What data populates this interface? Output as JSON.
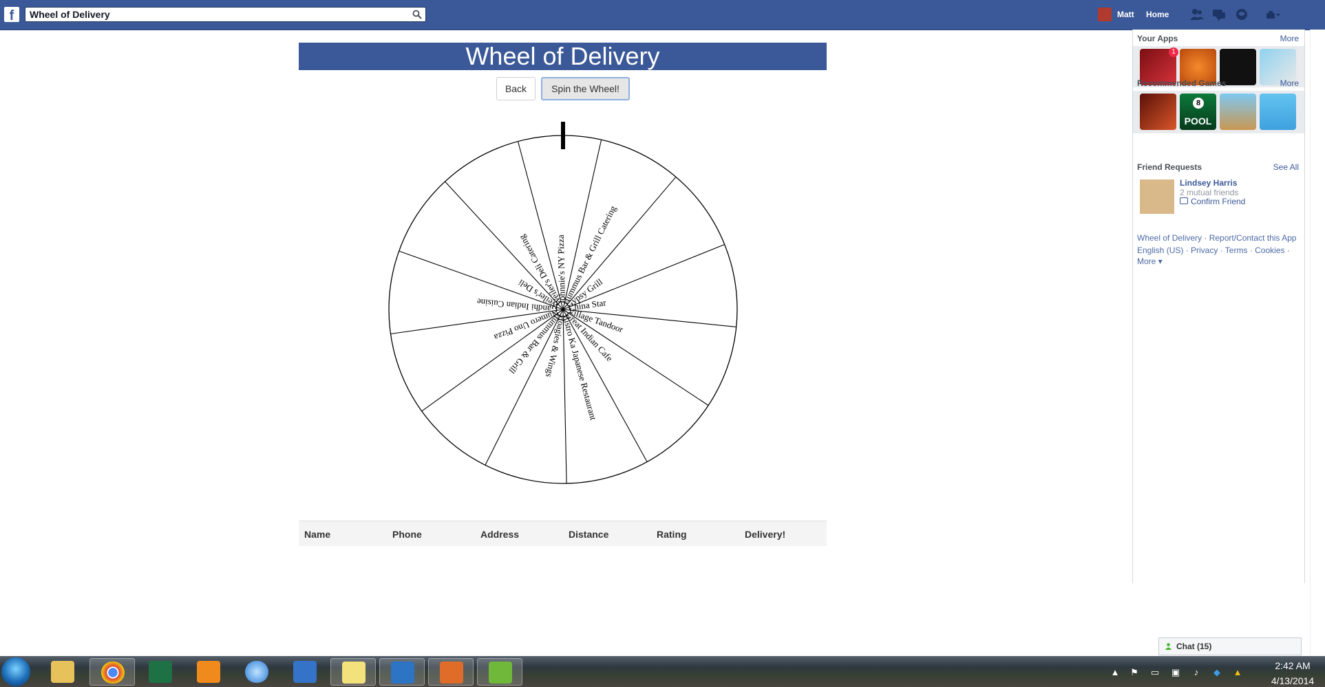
{
  "topbar": {
    "logo": "f",
    "search_value": "Wheel of Delivery",
    "user_name": "Matt",
    "home_label": "Home",
    "icons": [
      "friend-requests-icon",
      "messages-icon",
      "notifications-icon",
      "settings-icon"
    ]
  },
  "app": {
    "title": "Wheel of Delivery",
    "back_label": "Back",
    "spin_label": "Spin the Wheel!",
    "wheel_labels": [
      "Johnnie's NY Pizza",
      "Hummus Bar & Grill Catering",
      "Gypsy Grill",
      "China Star",
      "Village Tandoor",
      "Great Indian Cafe",
      "Bistro Ka Japanese Restaurant",
      "Hoagies & Wings",
      "Hummus Bar & Grill",
      "Numero Uno Pizza",
      "Gandhi Indian Cuisine",
      "Weiler's Deli",
      "Weiler's Deli Catering"
    ],
    "table_headers": [
      "Name",
      "Phone",
      "Address",
      "Distance",
      "Rating",
      "Delivery!"
    ]
  },
  "sidebar": {
    "your_apps": {
      "heading": "Your Apps",
      "more": "More",
      "badge": "1",
      "apps": [
        "poker-app-icon",
        "basketball-app-icon",
        "the-og-app-icon",
        "cow-app-icon"
      ]
    },
    "games": {
      "heading": "Recommended Games",
      "more": "More",
      "pool_label": "POOL",
      "pool_ball": "8",
      "games": [
        "warrior-game-icon",
        "pool-game-icon",
        "runner-game-icon",
        "bird-game-icon"
      ]
    },
    "friends": {
      "heading": "Friend Requests",
      "see_all": "See All",
      "name": "Lindsey Harris",
      "mutual": "2 mutual friends",
      "confirm": "Confirm Friend"
    },
    "footer": {
      "line1": "Wheel of Delivery · Report/Contact this App",
      "line2": "English (US) · Privacy · Terms · Cookies ·",
      "line3": "More ▾"
    }
  },
  "chat": {
    "label": "Chat (15)"
  },
  "taskbar": {
    "time": "2:42 AM",
    "date": "4/13/2014",
    "apps": [
      "explorer-icon",
      "chrome-icon",
      "excel-icon",
      "media-player-icon",
      "itunes-icon",
      "network-icon",
      "sticky-notes-icon",
      "remote-desktop-icon",
      "paint-icon",
      "snipping-tool-icon"
    ]
  },
  "colors": {
    "facebook_blue": "#3b5998",
    "link_blue": "#3b5998"
  }
}
